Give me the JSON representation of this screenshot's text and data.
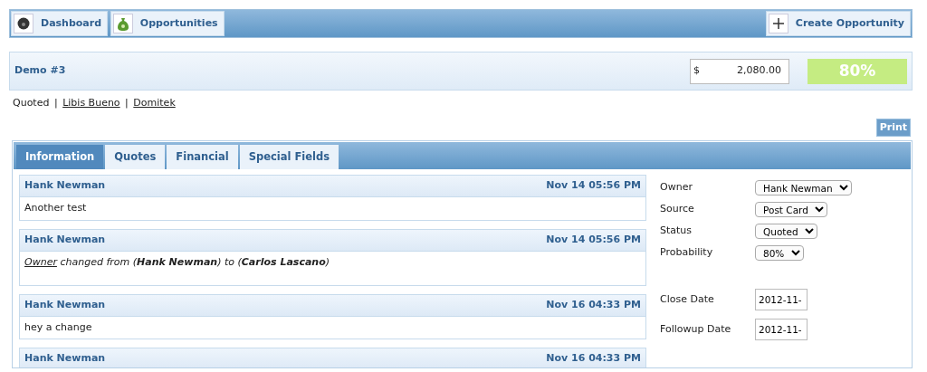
{
  "nav": {
    "items": [
      {
        "label": "Dashboard",
        "kind": "dashboard"
      },
      {
        "label": "Opportunities",
        "kind": "money"
      }
    ],
    "action": {
      "label": "Create Opportunity"
    }
  },
  "header": {
    "title": "Demo #3",
    "currency": "$",
    "amount": "2,080.00",
    "probability": "80%"
  },
  "breadcrumb": {
    "status": "Quoted",
    "separators": [
      "|",
      "|"
    ],
    "links": [
      "Libis Bueno",
      "Domitek"
    ]
  },
  "print_button": "Print",
  "tabs": [
    {
      "label": "Information",
      "selected": true
    },
    {
      "label": "Quotes",
      "selected": false
    },
    {
      "label": "Financial",
      "selected": false
    },
    {
      "label": "Special Fields",
      "selected": false
    }
  ],
  "notes": [
    {
      "author": "Hank Newman",
      "time": "Nov 14 05:56 PM",
      "kind": "text",
      "body": "Another test"
    },
    {
      "author": "Hank Newman",
      "time": "Nov 14 05:56 PM",
      "kind": "change",
      "field": "Owner",
      "body": " changed from (**Hank Newman**) to (**Carlos Lascano**)"
    },
    {
      "author": "Hank Newman",
      "time": "Nov 16 04:33 PM",
      "kind": "text",
      "body": "hey a change"
    },
    {
      "author": "Hank Newman",
      "time": "Nov 16 04:33 PM"
    }
  ],
  "form": {
    "selects": [
      {
        "label": "Owner",
        "value": "Hank Newman"
      },
      {
        "label": "Source",
        "value": "Post Card"
      },
      {
        "label": "Status",
        "value": "Quoted"
      },
      {
        "label": "Probability",
        "value": "80%"
      }
    ],
    "dates": [
      {
        "label": "Close Date",
        "value": "2012-11-"
      },
      {
        "label": "Followup Date",
        "value": "2012-11-"
      }
    ]
  }
}
